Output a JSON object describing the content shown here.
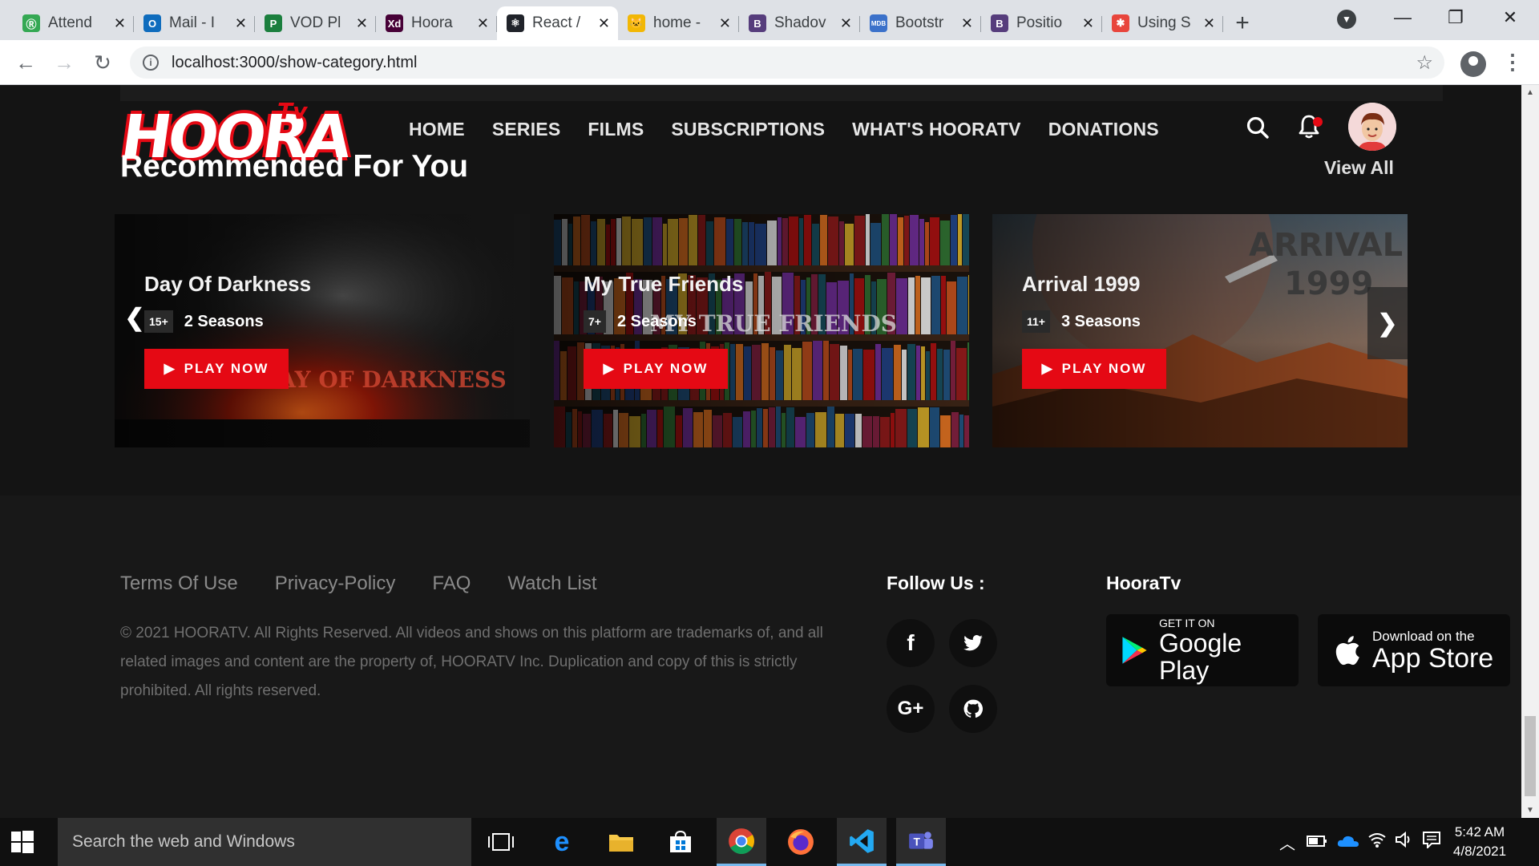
{
  "browser": {
    "tabs": [
      {
        "label": "Attend",
        "icon": "attendance-favicon",
        "color": "#34a853",
        "glyph": "Ⓡ"
      },
      {
        "label": "Mail - I",
        "icon": "outlook-favicon",
        "color": "#0f6cbd",
        "glyph": "O"
      },
      {
        "label": "VOD Pl",
        "icon": "planner-favicon",
        "color": "#1b7f3e",
        "glyph": "P"
      },
      {
        "label": "Hoora",
        "icon": "adobe-xd-favicon",
        "color": "#470137",
        "glyph": "Xd"
      },
      {
        "label": "React /",
        "icon": "react-favicon",
        "color": "#20232a",
        "glyph": "⚛",
        "active": true
      },
      {
        "label": "home -",
        "icon": "home-favicon",
        "color": "#f2b705",
        "glyph": "🐱"
      },
      {
        "label": "Shadov",
        "icon": "bootstrap-favicon",
        "color": "#563d7c",
        "glyph": "B"
      },
      {
        "label": "Bootstr",
        "icon": "mdb-favicon",
        "color": "#3b71ca",
        "glyph": "MDB"
      },
      {
        "label": "Positio",
        "icon": "bootstrap-favicon",
        "color": "#563d7c",
        "glyph": "B"
      },
      {
        "label": "Using S",
        "icon": "asterisk-favicon",
        "color": "#e8453c",
        "glyph": "✱"
      }
    ],
    "url": "localhost:3000/show-category.html"
  },
  "site": {
    "logo_text": "HOORA",
    "logo_tv": "Tv",
    "nav": [
      "HOME",
      "SERIES",
      "FILMS",
      "SUBSCRIPTIONS",
      "WHAT'S HOORATV",
      "DONATIONS"
    ],
    "section_title": "Recommended For You",
    "view_all": "View All",
    "cards": [
      {
        "title": "Day Of Darkness",
        "rating": "15+",
        "seasons": "2 Seasons",
        "cta": "PLAY NOW",
        "poster_text": "DAY OF DARKNESS"
      },
      {
        "title": "My True Friends",
        "rating": "7+",
        "seasons": "2 Seasons",
        "cta": "PLAY NOW",
        "poster_text": "MY TRUE FRIENDS"
      },
      {
        "title": "Arrival 1999",
        "rating": "11+",
        "seasons": "3 Seasons",
        "cta": "PLAY NOW",
        "poster_text_1": "ARRIVAL",
        "poster_text_2": "1999"
      }
    ],
    "footer": {
      "links": [
        "Terms Of Use",
        "Privacy-Policy",
        "FAQ",
        "Watch List"
      ],
      "copyright": "© 2021 HOORATV. All Rights Reserved. All videos and shows on this platform are trademarks of, and all related images and content are the property of, HOORATV Inc. Duplication and copy of this is strictly prohibited. All rights reserved.",
      "follow_title": "Follow Us :",
      "brand_title": "HooraTv",
      "social": [
        {
          "name": "facebook-icon",
          "glyph": "f"
        },
        {
          "name": "twitter-icon",
          "glyph": "🐦"
        },
        {
          "name": "google-plus-icon",
          "glyph": "G+"
        },
        {
          "name": "github-icon",
          "glyph": "⊙"
        }
      ],
      "google_play": {
        "small": "GET IT ON",
        "big": "Google Play"
      },
      "app_store": {
        "small": "Download on the",
        "big": "App Store"
      }
    }
  },
  "taskbar": {
    "search_placeholder": "Search the web and Windows",
    "time": "5:42 AM",
    "date": "4/8/2021"
  },
  "colors": {
    "accent": "#e50914",
    "background": "#141414",
    "footer": "#181818"
  }
}
